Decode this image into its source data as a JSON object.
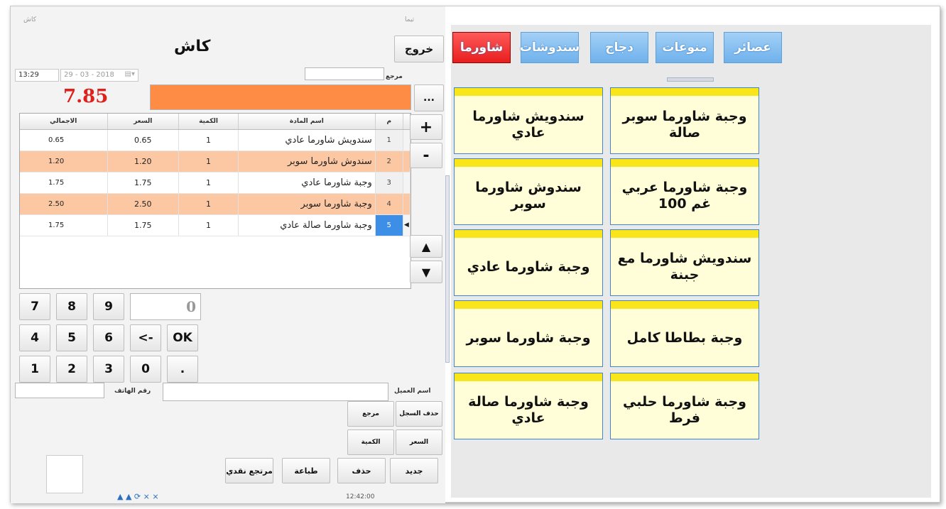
{
  "window": {
    "title": "كاش",
    "title_right": "تيما"
  },
  "header": {
    "page_title": "كاش",
    "exit_label": "خروج",
    "ref_label": "مرجع",
    "time": "13:29",
    "date": "29 - 03 - 2018"
  },
  "totals": {
    "grand_total": "7.85",
    "more_label": "..."
  },
  "grid": {
    "headers": {
      "total": "الاجمالي",
      "price": "السعر",
      "qty": "الكمية",
      "name": "اسم المادة",
      "idx": "م"
    },
    "rows": [
      {
        "idx": "1",
        "name": "سندويش شاورما عادي",
        "qty": "1",
        "price": "0.65",
        "total": "0.65"
      },
      {
        "idx": "2",
        "name": "سندوش شاورما سوبر",
        "qty": "1",
        "price": "1.20",
        "total": "1.20"
      },
      {
        "idx": "3",
        "name": "وجبة شاورما عادي",
        "qty": "1",
        "price": "1.75",
        "total": "1.75"
      },
      {
        "idx": "4",
        "name": "وجبة شاورما سوبر",
        "qty": "1",
        "price": "2.50",
        "total": "2.50"
      },
      {
        "idx": "5",
        "name": "وجبة شاورما صالة عادي",
        "qty": "1",
        "price": "1.75",
        "total": "1.75"
      }
    ]
  },
  "side_buttons": {
    "plus": "+",
    "minus": "-",
    "up": "▲",
    "down": "▼"
  },
  "keypad": {
    "value": "0",
    "keys": [
      "7",
      "8",
      "9",
      "4",
      "5",
      "6",
      "<-",
      "OK",
      "1",
      "2",
      "3",
      "0",
      "."
    ]
  },
  "customer": {
    "name_label": "اسم العميل",
    "phone_label": "رقم الهاتف"
  },
  "actions": {
    "delete_record": "حذف السجل",
    "reference": "مرجع",
    "price": "السعر",
    "quantity": "الكمية",
    "new": "جديد",
    "delete": "حذف",
    "print": "طباعة",
    "cash_return": "مرتجع نقدي",
    "status_time": "12:42:00"
  },
  "categories": [
    {
      "label": "شاورما",
      "active": true
    },
    {
      "label": "سندوشات",
      "active": false
    },
    {
      "label": "دجاج",
      "active": false
    },
    {
      "label": "منوعات",
      "active": false
    },
    {
      "label": "عصائر",
      "active": false
    }
  ],
  "products": [
    {
      "label": "وجبة شاورما سوبر صالة"
    },
    {
      "label": "سندويش شاورما عادي"
    },
    {
      "label": "وجبة شاورما عربي غم 100"
    },
    {
      "label": "سندوش شاورما سوبر"
    },
    {
      "label": "سندويش شاورما مع جبنة"
    },
    {
      "label": "وجبة شاورما عادي"
    },
    {
      "label": "وجبة بطاطا كامل"
    },
    {
      "label": "وجبة شاورما سوبر"
    },
    {
      "label": "وجبة شاورما حلبي فرط"
    },
    {
      "label": "وجبة شاورما صالة عادي"
    }
  ],
  "colors": {
    "total_red": "#e0201a",
    "orange_bar": "#ff8c45",
    "active_tab": "#e81e1e",
    "tab_blue": "#6fb1ec",
    "tile_yellow": "#f8e61a",
    "row_alt": "#fcc7a3"
  }
}
